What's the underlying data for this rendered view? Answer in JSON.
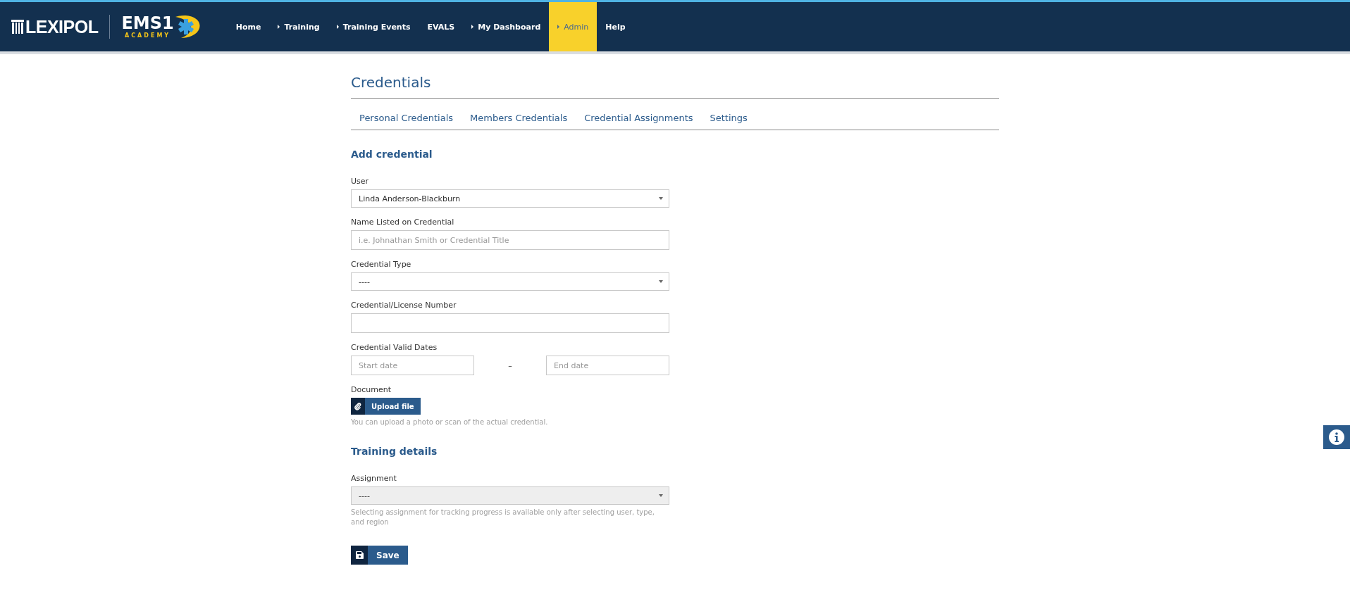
{
  "header": {
    "logo": {
      "brand": "LEXIPOL",
      "product": "EMS1",
      "sub": "ACADEMY"
    },
    "nav": [
      {
        "label": "Home",
        "has_submenu": false,
        "selected": false
      },
      {
        "label": "Training",
        "has_submenu": true,
        "selected": false
      },
      {
        "label": "Training Events",
        "has_submenu": true,
        "selected": false
      },
      {
        "label": "EVALS",
        "has_submenu": false,
        "selected": false
      },
      {
        "label": "My Dashboard",
        "has_submenu": true,
        "selected": false
      },
      {
        "label": "Admin",
        "has_submenu": true,
        "selected": true
      },
      {
        "label": "Help",
        "has_submenu": false,
        "selected": false
      }
    ]
  },
  "page": {
    "title": "Credentials",
    "tabs": [
      {
        "label": "Personal Credentials",
        "selected": false
      },
      {
        "label": "Members Credentials",
        "selected": false
      },
      {
        "label": "Credential Assignments",
        "selected": false
      },
      {
        "label": "Settings",
        "selected": false
      }
    ],
    "sections": [
      {
        "title": "Add credential",
        "fields": [
          {
            "kind": "select",
            "label": "User",
            "value": "Linda Anderson-Blackburn",
            "disabled": false
          },
          {
            "kind": "text",
            "label": "Name Listed on Credential",
            "placeholder": "i.e. Johnathan Smith or Credential Title"
          },
          {
            "kind": "select",
            "label": "Credential Type",
            "value": "----",
            "disabled": false
          },
          {
            "kind": "text",
            "label": "Credential/License Number"
          },
          {
            "kind": "date_range",
            "label": "Credential Valid Dates",
            "start_placeholder": "Start date",
            "separator": "–",
            "end_placeholder": "End date"
          },
          {
            "kind": "file",
            "label": "Document",
            "button": "Upload file",
            "help": "You can upload a photo or scan of the actual credential."
          }
        ]
      },
      {
        "title": "Training details",
        "fields": [
          {
            "kind": "select",
            "label": "Assignment",
            "value": "----",
            "disabled": true,
            "help": "Selecting assignment for tracking progress is available only after selecting user, type, and region"
          }
        ]
      }
    ],
    "save_button": "Save"
  }
}
